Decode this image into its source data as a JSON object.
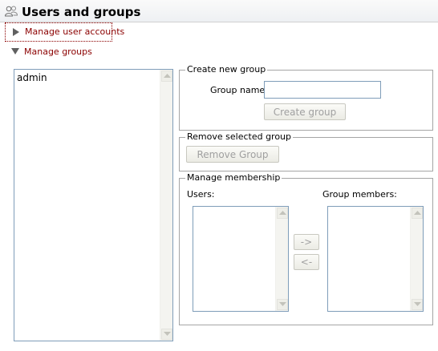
{
  "header": {
    "title": "Users and groups",
    "icon": "users-icon"
  },
  "sections": {
    "manage_users": {
      "label": "Manage user accounts",
      "expanded": false
    },
    "manage_groups": {
      "label": "Manage groups",
      "expanded": true
    }
  },
  "groups_list": {
    "items": [
      "admin"
    ]
  },
  "create_group": {
    "legend": "Create new group",
    "group_name_label": "Group name:",
    "group_name_value": "",
    "button_label": "Create group"
  },
  "remove_group": {
    "legend": "Remove selected group",
    "button_label": "Remove Group"
  },
  "membership": {
    "legend": "Manage membership",
    "users_label": "Users:",
    "members_label": "Group members:",
    "users_items": [],
    "members_items": [],
    "add_button_label": "->",
    "remove_button_label": "<-"
  },
  "colors": {
    "link": "#8b0000",
    "border": "#7f9db9",
    "disabled_text": "#a0a0a0"
  }
}
